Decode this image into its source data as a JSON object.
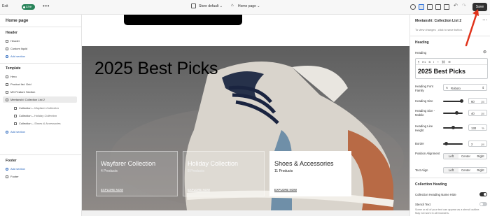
{
  "topbar": {
    "exit": "Exit",
    "status": "Live",
    "more": "•••",
    "store": "Store default",
    "page": "Home page",
    "save": "Save"
  },
  "sidebar": {
    "title": "Home page",
    "header_group": "Header",
    "header_items": [
      "Header",
      "Custom liquid"
    ],
    "add_section": "Add section",
    "template_group": "Template",
    "template_items": [
      "Hero",
      "Product list: Grid",
      "MX Feature Section",
      "Meetanshi: Collection List 2"
    ],
    "collection_items": [
      {
        "label": "Collection",
        "name": "Wayfarer Collection"
      },
      {
        "label": "Collection",
        "name": "Holiday Collection"
      },
      {
        "label": "Collection",
        "name": "Shoes & Accessories"
      }
    ],
    "footer_group": "Footer",
    "footer_items": [
      "Footer"
    ]
  },
  "preview": {
    "title": "2025 Best Picks",
    "cards": [
      {
        "title": "Wayfarer Collection",
        "count": "4 Products",
        "link": "EXPLORE NOW"
      },
      {
        "title": "Holiday Collection",
        "count": "8 Products",
        "link": "EXPLORE NOW"
      },
      {
        "title": "Shoes & Accessories",
        "count": "11 Products",
        "link": "EXPLORE NOW"
      }
    ]
  },
  "settings": {
    "title": "Meetanshi: Collection List 2",
    "hint": "To view changes , click to save button.",
    "heading_section": "Heading",
    "heading_label": "Heading",
    "toolbar": "¶ H1 B I ⌁ ⛓ ☰",
    "heading_value": "2025 Best Picks",
    "font_family_label": "Heading Font Family",
    "font_family_value": "Roboto",
    "size_label": "Heading Size",
    "size_value": "60",
    "size_mobile_label": "Heading Size - Mobile",
    "size_mobile_value": "40",
    "line_height_label": "Heading Line Height",
    "line_height_value": "130",
    "border_label": "Border",
    "border_value": "2",
    "unit_px": "px",
    "unit_pct": "%",
    "position_label": "Position Alignment",
    "text_align_label": "Text Align",
    "align_options": [
      "Left",
      "Center",
      "Right"
    ],
    "collection_heading_section": "Collection Heading",
    "name_hide_label": "Collection Heading Name Hide",
    "stencil_label": "Stencil Text",
    "stencil_hint": "Some or all of your text can appear as a stencil outline. May not work in all browsers."
  },
  "colors": {
    "live": "#29845a",
    "save": "#303030",
    "link": "#2463bc",
    "arrow": "#e0331b"
  }
}
